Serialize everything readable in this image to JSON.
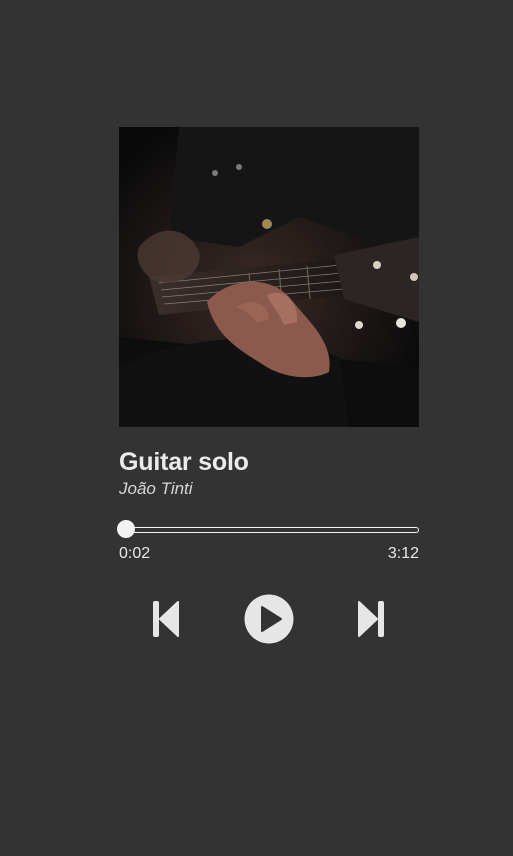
{
  "track": {
    "title": "Guitar solo",
    "artist": "João Tinti",
    "cover_icon": "album-art-guitar"
  },
  "progress": {
    "current_time": "0:02",
    "total_time": "3:12",
    "fraction": 0.0104
  },
  "controls": {
    "previous_icon": "skip-previous-icon",
    "play_icon": "play-icon",
    "next_icon": "skip-next-icon"
  },
  "colors": {
    "background": "#333333",
    "foreground": "#ececec",
    "control_fill": "#e6e6e6"
  }
}
